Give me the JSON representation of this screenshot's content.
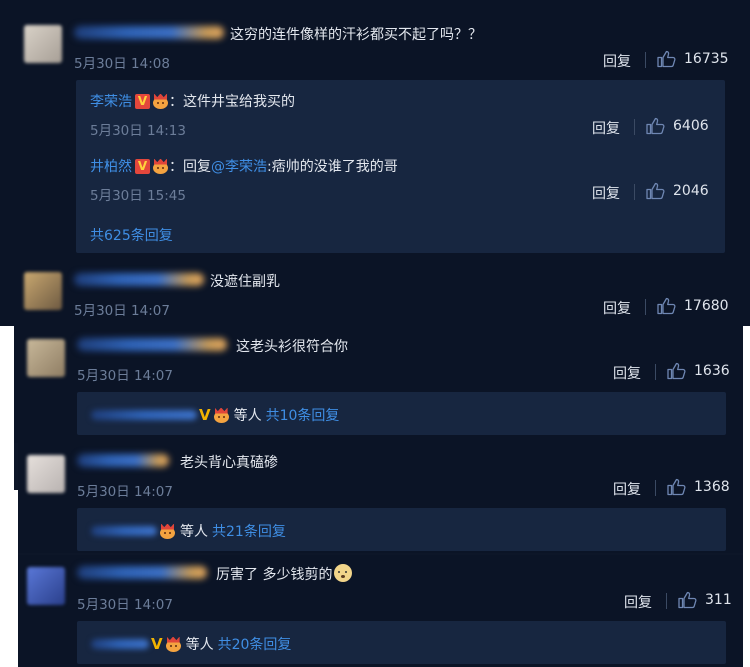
{
  "comments": [
    {
      "text": "这穷的连件像样的汗衫都买不起了吗？？",
      "time": "5月30日 14:08",
      "reply_label": "回复",
      "likes": "16735",
      "replies": [
        {
          "name": "李荣浩",
          "prefix": "：",
          "text": "这件井宝给我买的",
          "time": "5月30日 14:13",
          "reply_label": "回复",
          "likes": "6406"
        },
        {
          "name": "井柏然",
          "prefix": "：回复",
          "mention": "@李荣浩",
          "text": ":痞帅的没谁了我的哥",
          "time": "5月30日 15:45",
          "reply_label": "回复",
          "likes": "2046"
        }
      ],
      "more_replies": "共625条回复"
    },
    {
      "text": "没遮住副乳",
      "time": "5月30日 14:07",
      "reply_label": "回复",
      "likes": "17680"
    },
    {
      "text": "这老头衫很符合你",
      "time": "5月30日 14:07",
      "reply_label": "回复",
      "likes": "1636",
      "summary_etc": "等人",
      "summary_total": "共10条回复"
    },
    {
      "text": "老头背心真磕碜",
      "time": "5月30日 14:07",
      "reply_label": "回复",
      "likes": "1368",
      "summary_etc": "等人",
      "summary_total": "共21条回复"
    },
    {
      "text": "厉害了 多少钱剪的",
      "time": "5月30日 14:07",
      "reply_label": "回复",
      "likes": "311",
      "summary_etc": "等人",
      "summary_total": "共20条回复"
    }
  ],
  "icons": {
    "like": "thumbs-up-icon",
    "verified": "verified-v-icon",
    "member": "crown-avatar-icon",
    "emoji": "doge-emoji-icon"
  },
  "colors": {
    "background": "#0d1628",
    "reply_box": "#172640",
    "link": "#3f8ee4",
    "time": "#6c7d99",
    "text": "#e3e7ee",
    "verified_red": "#e4473c"
  }
}
